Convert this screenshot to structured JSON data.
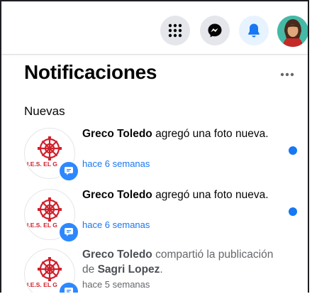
{
  "header": {
    "menu_icon": "grid-menu-icon",
    "messenger_icon": "messenger-icon",
    "notifications_icon": "bell-icon",
    "avatar": "user-avatar"
  },
  "panel": {
    "title": "Notificaciones",
    "more_icon": "ellipsis-icon",
    "section": "Nuevas"
  },
  "notifications": [
    {
      "actor": "Greco Toledo",
      "action": " agregó una foto nueva.",
      "target": "",
      "suffix": "",
      "time": "hace 6 semanas",
      "unread": true,
      "avatar_label": "I.E.S. EL G"
    },
    {
      "actor": "Greco Toledo",
      "action": " agregó una foto nueva.",
      "target": "",
      "suffix": "",
      "time": "hace 6 semanas",
      "unread": true,
      "avatar_label": "I.E.S. EL G"
    },
    {
      "actor": "Greco Toledo",
      "action": " compartió la publicación de ",
      "target": "Sagri Lopez",
      "suffix": ".",
      "time": "hace 5 semanas",
      "unread": false,
      "avatar_label": "I.E.S. EL G"
    }
  ],
  "colors": {
    "accent": "#1877f2",
    "badge": "#2d88ff",
    "logo_red": "#d0202c"
  }
}
